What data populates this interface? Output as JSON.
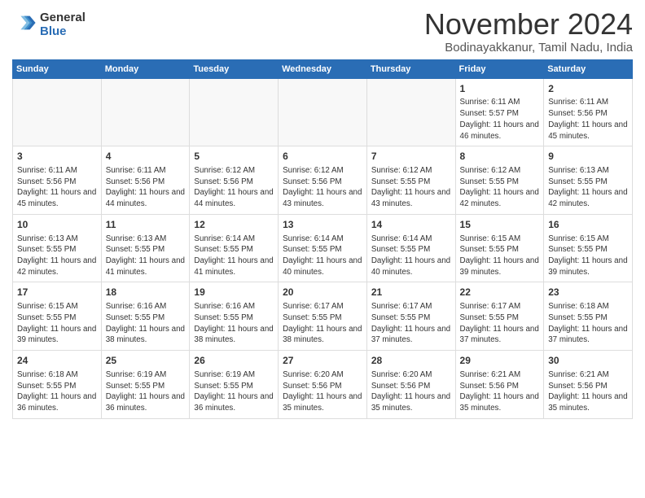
{
  "header": {
    "logo_line1": "General",
    "logo_line2": "Blue",
    "month_title": "November 2024",
    "location": "Bodinayakkanur, Tamil Nadu, India"
  },
  "weekdays": [
    "Sunday",
    "Monday",
    "Tuesday",
    "Wednesday",
    "Thursday",
    "Friday",
    "Saturday"
  ],
  "weeks": [
    [
      {
        "day": "",
        "info": ""
      },
      {
        "day": "",
        "info": ""
      },
      {
        "day": "",
        "info": ""
      },
      {
        "day": "",
        "info": ""
      },
      {
        "day": "",
        "info": ""
      },
      {
        "day": "1",
        "info": "Sunrise: 6:11 AM\nSunset: 5:57 PM\nDaylight: 11 hours\nand 46 minutes."
      },
      {
        "day": "2",
        "info": "Sunrise: 6:11 AM\nSunset: 5:56 PM\nDaylight: 11 hours\nand 45 minutes."
      }
    ],
    [
      {
        "day": "3",
        "info": "Sunrise: 6:11 AM\nSunset: 5:56 PM\nDaylight: 11 hours\nand 45 minutes."
      },
      {
        "day": "4",
        "info": "Sunrise: 6:11 AM\nSunset: 5:56 PM\nDaylight: 11 hours\nand 44 minutes."
      },
      {
        "day": "5",
        "info": "Sunrise: 6:12 AM\nSunset: 5:56 PM\nDaylight: 11 hours\nand 44 minutes."
      },
      {
        "day": "6",
        "info": "Sunrise: 6:12 AM\nSunset: 5:56 PM\nDaylight: 11 hours\nand 43 minutes."
      },
      {
        "day": "7",
        "info": "Sunrise: 6:12 AM\nSunset: 5:55 PM\nDaylight: 11 hours\nand 43 minutes."
      },
      {
        "day": "8",
        "info": "Sunrise: 6:12 AM\nSunset: 5:55 PM\nDaylight: 11 hours\nand 42 minutes."
      },
      {
        "day": "9",
        "info": "Sunrise: 6:13 AM\nSunset: 5:55 PM\nDaylight: 11 hours\nand 42 minutes."
      }
    ],
    [
      {
        "day": "10",
        "info": "Sunrise: 6:13 AM\nSunset: 5:55 PM\nDaylight: 11 hours\nand 42 minutes."
      },
      {
        "day": "11",
        "info": "Sunrise: 6:13 AM\nSunset: 5:55 PM\nDaylight: 11 hours\nand 41 minutes."
      },
      {
        "day": "12",
        "info": "Sunrise: 6:14 AM\nSunset: 5:55 PM\nDaylight: 11 hours\nand 41 minutes."
      },
      {
        "day": "13",
        "info": "Sunrise: 6:14 AM\nSunset: 5:55 PM\nDaylight: 11 hours\nand 40 minutes."
      },
      {
        "day": "14",
        "info": "Sunrise: 6:14 AM\nSunset: 5:55 PM\nDaylight: 11 hours\nand 40 minutes."
      },
      {
        "day": "15",
        "info": "Sunrise: 6:15 AM\nSunset: 5:55 PM\nDaylight: 11 hours\nand 39 minutes."
      },
      {
        "day": "16",
        "info": "Sunrise: 6:15 AM\nSunset: 5:55 PM\nDaylight: 11 hours\nand 39 minutes."
      }
    ],
    [
      {
        "day": "17",
        "info": "Sunrise: 6:15 AM\nSunset: 5:55 PM\nDaylight: 11 hours\nand 39 minutes."
      },
      {
        "day": "18",
        "info": "Sunrise: 6:16 AM\nSunset: 5:55 PM\nDaylight: 11 hours\nand 38 minutes."
      },
      {
        "day": "19",
        "info": "Sunrise: 6:16 AM\nSunset: 5:55 PM\nDaylight: 11 hours\nand 38 minutes."
      },
      {
        "day": "20",
        "info": "Sunrise: 6:17 AM\nSunset: 5:55 PM\nDaylight: 11 hours\nand 38 minutes."
      },
      {
        "day": "21",
        "info": "Sunrise: 6:17 AM\nSunset: 5:55 PM\nDaylight: 11 hours\nand 37 minutes."
      },
      {
        "day": "22",
        "info": "Sunrise: 6:17 AM\nSunset: 5:55 PM\nDaylight: 11 hours\nand 37 minutes."
      },
      {
        "day": "23",
        "info": "Sunrise: 6:18 AM\nSunset: 5:55 PM\nDaylight: 11 hours\nand 37 minutes."
      }
    ],
    [
      {
        "day": "24",
        "info": "Sunrise: 6:18 AM\nSunset: 5:55 PM\nDaylight: 11 hours\nand 36 minutes."
      },
      {
        "day": "25",
        "info": "Sunrise: 6:19 AM\nSunset: 5:55 PM\nDaylight: 11 hours\nand 36 minutes."
      },
      {
        "day": "26",
        "info": "Sunrise: 6:19 AM\nSunset: 5:55 PM\nDaylight: 11 hours\nand 36 minutes."
      },
      {
        "day": "27",
        "info": "Sunrise: 6:20 AM\nSunset: 5:56 PM\nDaylight: 11 hours\nand 35 minutes."
      },
      {
        "day": "28",
        "info": "Sunrise: 6:20 AM\nSunset: 5:56 PM\nDaylight: 11 hours\nand 35 minutes."
      },
      {
        "day": "29",
        "info": "Sunrise: 6:21 AM\nSunset: 5:56 PM\nDaylight: 11 hours\nand 35 minutes."
      },
      {
        "day": "30",
        "info": "Sunrise: 6:21 AM\nSunset: 5:56 PM\nDaylight: 11 hours\nand 35 minutes."
      }
    ]
  ]
}
